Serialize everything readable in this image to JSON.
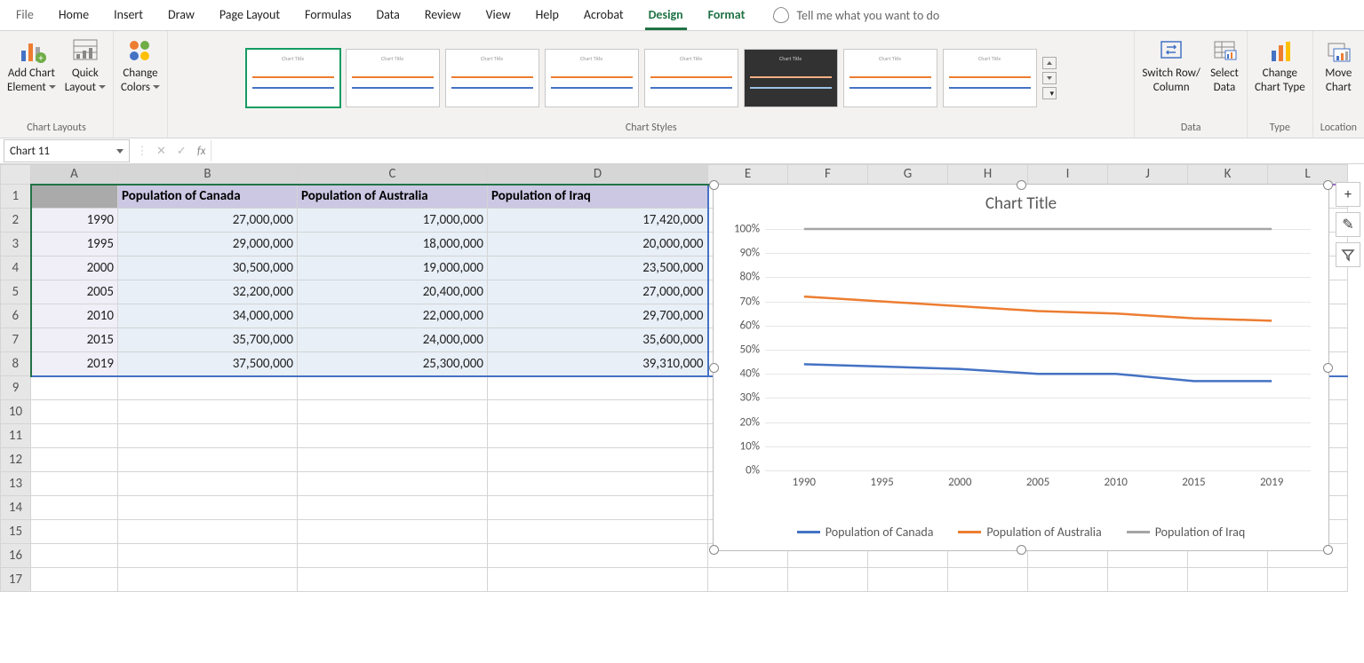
{
  "tabs": {
    "items": [
      "File",
      "Home",
      "Insert",
      "Draw",
      "Page Layout",
      "Formulas",
      "Data",
      "Review",
      "View",
      "Help",
      "Acrobat",
      "Design",
      "Format"
    ],
    "active": "Design",
    "tellme": "Tell me what you want to do"
  },
  "ribbon": {
    "chart_layouts": {
      "add_chart_element": "Add Chart\nElement",
      "quick_layout": "Quick\nLayout",
      "label": "Chart Layouts"
    },
    "change_colors": "Change\nColors",
    "styles_label": "Chart Styles",
    "data_group": {
      "switch": "Switch Row/\nColumn",
      "select": "Select\nData",
      "label": "Data"
    },
    "type_group": {
      "change_type": "Change\nChart Type",
      "label": "Type"
    },
    "location_group": {
      "move": "Move\nChart",
      "label": "Location"
    }
  },
  "namebox": "Chart 11",
  "fx_label": "fx",
  "columns": [
    "A",
    "B",
    "C",
    "D",
    "E",
    "F",
    "G",
    "H",
    "I",
    "J",
    "K",
    "L"
  ],
  "row_headers": [
    1,
    2,
    3,
    4,
    5,
    6,
    7,
    8,
    9,
    10,
    11,
    12,
    13,
    14,
    15,
    16,
    17
  ],
  "table": {
    "headers": [
      "",
      "Population of Canada",
      "Population of Australia",
      "Population of Iraq"
    ],
    "rows": [
      {
        "year": "1990",
        "b": "27,000,000",
        "c": "17,000,000",
        "d": "17,420,000"
      },
      {
        "year": "1995",
        "b": "29,000,000",
        "c": "18,000,000",
        "d": "20,000,000"
      },
      {
        "year": "2000",
        "b": "30,500,000",
        "c": "19,000,000",
        "d": "23,500,000"
      },
      {
        "year": "2005",
        "b": "32,200,000",
        "c": "20,400,000",
        "d": "27,000,000"
      },
      {
        "year": "2010",
        "b": "34,000,000",
        "c": "22,000,000",
        "d": "29,700,000"
      },
      {
        "year": "2015",
        "b": "35,700,000",
        "c": "24,000,000",
        "d": "35,600,000"
      },
      {
        "year": "2019",
        "b": "37,500,000",
        "c": "25,300,000",
        "d": "39,310,000"
      }
    ]
  },
  "chart": {
    "title": "Chart Title",
    "legend": [
      "Population of Canada",
      "Population of Australia",
      "Population of Iraq"
    ]
  },
  "side": {
    "plus": "+",
    "brush": "✎",
    "filter": "▾"
  },
  "colors": {
    "s1": "#4472c4",
    "s2": "#ed7d31",
    "s3": "#a5a5a5"
  },
  "chart_data": {
    "type": "line",
    "note": "100% stacked line — each series is cumulative share of row total",
    "title": "Chart Title",
    "xlabel": "",
    "ylabel": "",
    "categories": [
      "1990",
      "1995",
      "2000",
      "2005",
      "2010",
      "2015",
      "2019"
    ],
    "y_ticks": [
      "0%",
      "10%",
      "20%",
      "30%",
      "40%",
      "50%",
      "60%",
      "70%",
      "80%",
      "90%",
      "100%"
    ],
    "ylim": [
      0,
      100
    ],
    "series": [
      {
        "name": "Population of Canada",
        "color": "#4472c4",
        "values": [
          44,
          43,
          42,
          40,
          40,
          37,
          37
        ]
      },
      {
        "name": "Population of Australia",
        "color": "#ed7d31",
        "values": [
          72,
          70,
          68,
          66,
          65,
          63,
          62
        ]
      },
      {
        "name": "Population of Iraq",
        "color": "#a5a5a5",
        "values": [
          100,
          100,
          100,
          100,
          100,
          100,
          100
        ]
      }
    ],
    "legend_position": "bottom"
  }
}
